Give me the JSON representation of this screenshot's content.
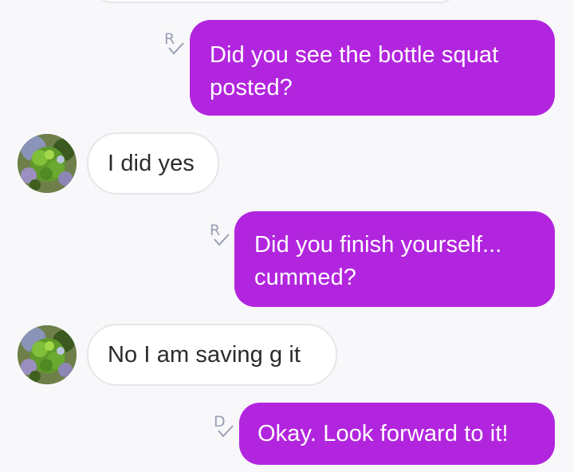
{
  "messages": [
    {
      "direction": "sent",
      "status": "R",
      "text_line1": "Did you see the bottle squat",
      "text_line2": "posted?"
    },
    {
      "direction": "received",
      "text": "I did yes"
    },
    {
      "direction": "sent",
      "status": "R",
      "text_line1": "Did you finish yourself...",
      "text_line2": "cummed?"
    },
    {
      "direction": "received",
      "text": "No I am saving g it"
    },
    {
      "direction": "sent",
      "status": "D",
      "text": "Okay. Look forward to it!"
    }
  ],
  "colors": {
    "sent_bubble": "#b225de",
    "received_bubble": "#ffffff",
    "received_border": "#e6e6ea",
    "background": "#f8f8fa",
    "status_icon": "#9a9fb4"
  },
  "icons": {
    "read_receipt": "read-receipt-icon",
    "delivered_receipt": "delivered-receipt-icon",
    "contact_avatar": "contact-avatar"
  }
}
